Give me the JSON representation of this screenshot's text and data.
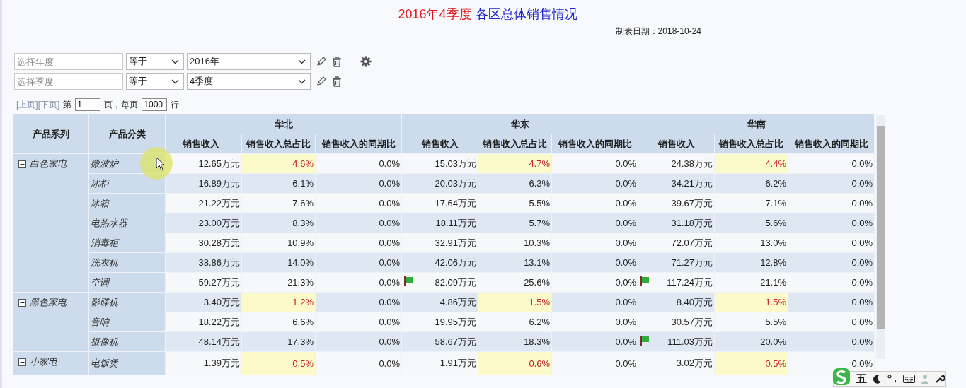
{
  "title": {
    "period": "2016年4季度",
    "main": "各区总体销售情况"
  },
  "report_date": "制表日期：2018-10-24",
  "filters": [
    {
      "placeholder": "选择年度",
      "operator": "等于",
      "value": "2016年"
    },
    {
      "placeholder": "选择季度",
      "operator": "等于",
      "value": "4季度"
    }
  ],
  "pagination": {
    "prev": "[上页]",
    "next": "[下页]",
    "page_label": "第",
    "page": "1",
    "per_page_label": "页，每页",
    "per_page": "1000",
    "rows_label": "行"
  },
  "table": {
    "columns": [
      "产品系列",
      "产品分类"
    ],
    "regions": [
      "华北",
      "华东",
      "华南"
    ],
    "measures": [
      [
        "销售收入↑",
        "销售收入总占比",
        "销售收入的同期比"
      ],
      [
        "销售收入",
        "销售收入总占比",
        "销售收入的同期比"
      ],
      [
        "销售收入",
        "销售收入总占比",
        "销售收入的同期比"
      ]
    ],
    "groups": [
      {
        "name": "白色家电",
        "expanded": true,
        "rows": [
          {
            "category": "微波炉",
            "cells": [
              {
                "revenue": "12.65万元",
                "flag": false,
                "share": "4.6%",
                "highlight": true,
                "yoy": "0.0%"
              },
              {
                "revenue": "15.03万元",
                "flag": false,
                "share": "4.7%",
                "highlight": true,
                "yoy": "0.0%"
              },
              {
                "revenue": "24.38万元",
                "flag": false,
                "share": "4.4%",
                "highlight": true,
                "yoy": "0.0%"
              }
            ]
          },
          {
            "category": "冰柜",
            "cells": [
              {
                "revenue": "16.89万元",
                "flag": false,
                "share": "6.1%",
                "highlight": false,
                "yoy": "0.0%"
              },
              {
                "revenue": "20.03万元",
                "flag": false,
                "share": "6.3%",
                "highlight": false,
                "yoy": "0.0%"
              },
              {
                "revenue": "34.21万元",
                "flag": false,
                "share": "6.2%",
                "highlight": false,
                "yoy": "0.0%"
              }
            ]
          },
          {
            "category": "冰箱",
            "cells": [
              {
                "revenue": "21.22万元",
                "flag": false,
                "share": "7.6%",
                "highlight": false,
                "yoy": "0.0%"
              },
              {
                "revenue": "17.64万元",
                "flag": false,
                "share": "5.5%",
                "highlight": false,
                "yoy": "0.0%"
              },
              {
                "revenue": "39.67万元",
                "flag": false,
                "share": "7.1%",
                "highlight": false,
                "yoy": "0.0%"
              }
            ]
          },
          {
            "category": "电热水器",
            "cells": [
              {
                "revenue": "23.00万元",
                "flag": false,
                "share": "8.3%",
                "highlight": false,
                "yoy": "0.0%"
              },
              {
                "revenue": "18.11万元",
                "flag": false,
                "share": "5.7%",
                "highlight": false,
                "yoy": "0.0%"
              },
              {
                "revenue": "31.18万元",
                "flag": false,
                "share": "5.6%",
                "highlight": false,
                "yoy": "0.0%"
              }
            ]
          },
          {
            "category": "消毒柜",
            "cells": [
              {
                "revenue": "30.28万元",
                "flag": false,
                "share": "10.9%",
                "highlight": false,
                "yoy": "0.0%"
              },
              {
                "revenue": "32.91万元",
                "flag": false,
                "share": "10.3%",
                "highlight": false,
                "yoy": "0.0%"
              },
              {
                "revenue": "72.07万元",
                "flag": false,
                "share": "13.0%",
                "highlight": false,
                "yoy": "0.0%"
              }
            ]
          },
          {
            "category": "洗衣机",
            "cells": [
              {
                "revenue": "38.86万元",
                "flag": false,
                "share": "14.0%",
                "highlight": false,
                "yoy": "0.0%"
              },
              {
                "revenue": "42.06万元",
                "flag": false,
                "share": "13.1%",
                "highlight": false,
                "yoy": "0.0%"
              },
              {
                "revenue": "71.27万元",
                "flag": false,
                "share": "12.8%",
                "highlight": false,
                "yoy": "0.0%"
              }
            ]
          },
          {
            "category": "空调",
            "cells": [
              {
                "revenue": "59.27万元",
                "flag": false,
                "share": "21.3%",
                "highlight": false,
                "yoy": "0.0%"
              },
              {
                "revenue": "82.09万元",
                "flag": true,
                "share": "25.6%",
                "highlight": false,
                "yoy": "0.0%"
              },
              {
                "revenue": "117.24万元",
                "flag": true,
                "share": "21.1%",
                "highlight": false,
                "yoy": "0.0%"
              }
            ]
          }
        ]
      },
      {
        "name": "黑色家电",
        "expanded": true,
        "rows": [
          {
            "category": "影碟机",
            "cells": [
              {
                "revenue": "3.40万元",
                "flag": false,
                "share": "1.2%",
                "highlight": true,
                "yoy": "0.0%"
              },
              {
                "revenue": "4.86万元",
                "flag": false,
                "share": "1.5%",
                "highlight": true,
                "yoy": "0.0%"
              },
              {
                "revenue": "8.40万元",
                "flag": false,
                "share": "1.5%",
                "highlight": true,
                "yoy": "0.0%"
              }
            ]
          },
          {
            "category": "音响",
            "cells": [
              {
                "revenue": "18.22万元",
                "flag": false,
                "share": "6.6%",
                "highlight": false,
                "yoy": "0.0%"
              },
              {
                "revenue": "19.95万元",
                "flag": false,
                "share": "6.2%",
                "highlight": false,
                "yoy": "0.0%"
              },
              {
                "revenue": "30.57万元",
                "flag": false,
                "share": "5.5%",
                "highlight": false,
                "yoy": "0.0%"
              }
            ]
          },
          {
            "category": "摄像机",
            "cells": [
              {
                "revenue": "48.14万元",
                "flag": false,
                "share": "17.3%",
                "highlight": false,
                "yoy": "0.0%"
              },
              {
                "revenue": "58.67万元",
                "flag": false,
                "share": "18.3%",
                "highlight": false,
                "yoy": "0.0%"
              },
              {
                "revenue": "111.03万元",
                "flag": true,
                "share": "20.0%",
                "highlight": false,
                "yoy": "0.0%"
              }
            ]
          }
        ]
      },
      {
        "name": "小家电",
        "expanded": true,
        "rows": [
          {
            "category": "电饭煲",
            "cells": [
              {
                "revenue": "1.39万元",
                "flag": false,
                "share": "0.5%",
                "highlight": true,
                "yoy": "0.0%"
              },
              {
                "revenue": "1.91万元",
                "flag": false,
                "share": "0.6%",
                "highlight": true,
                "yoy": "0.0%"
              },
              {
                "revenue": "3.02万元",
                "flag": false,
                "share": "0.5%",
                "highlight": true,
                "yoy": "0.0%"
              }
            ]
          }
        ]
      }
    ]
  },
  "ime_toolbar": {
    "mode": "五"
  }
}
